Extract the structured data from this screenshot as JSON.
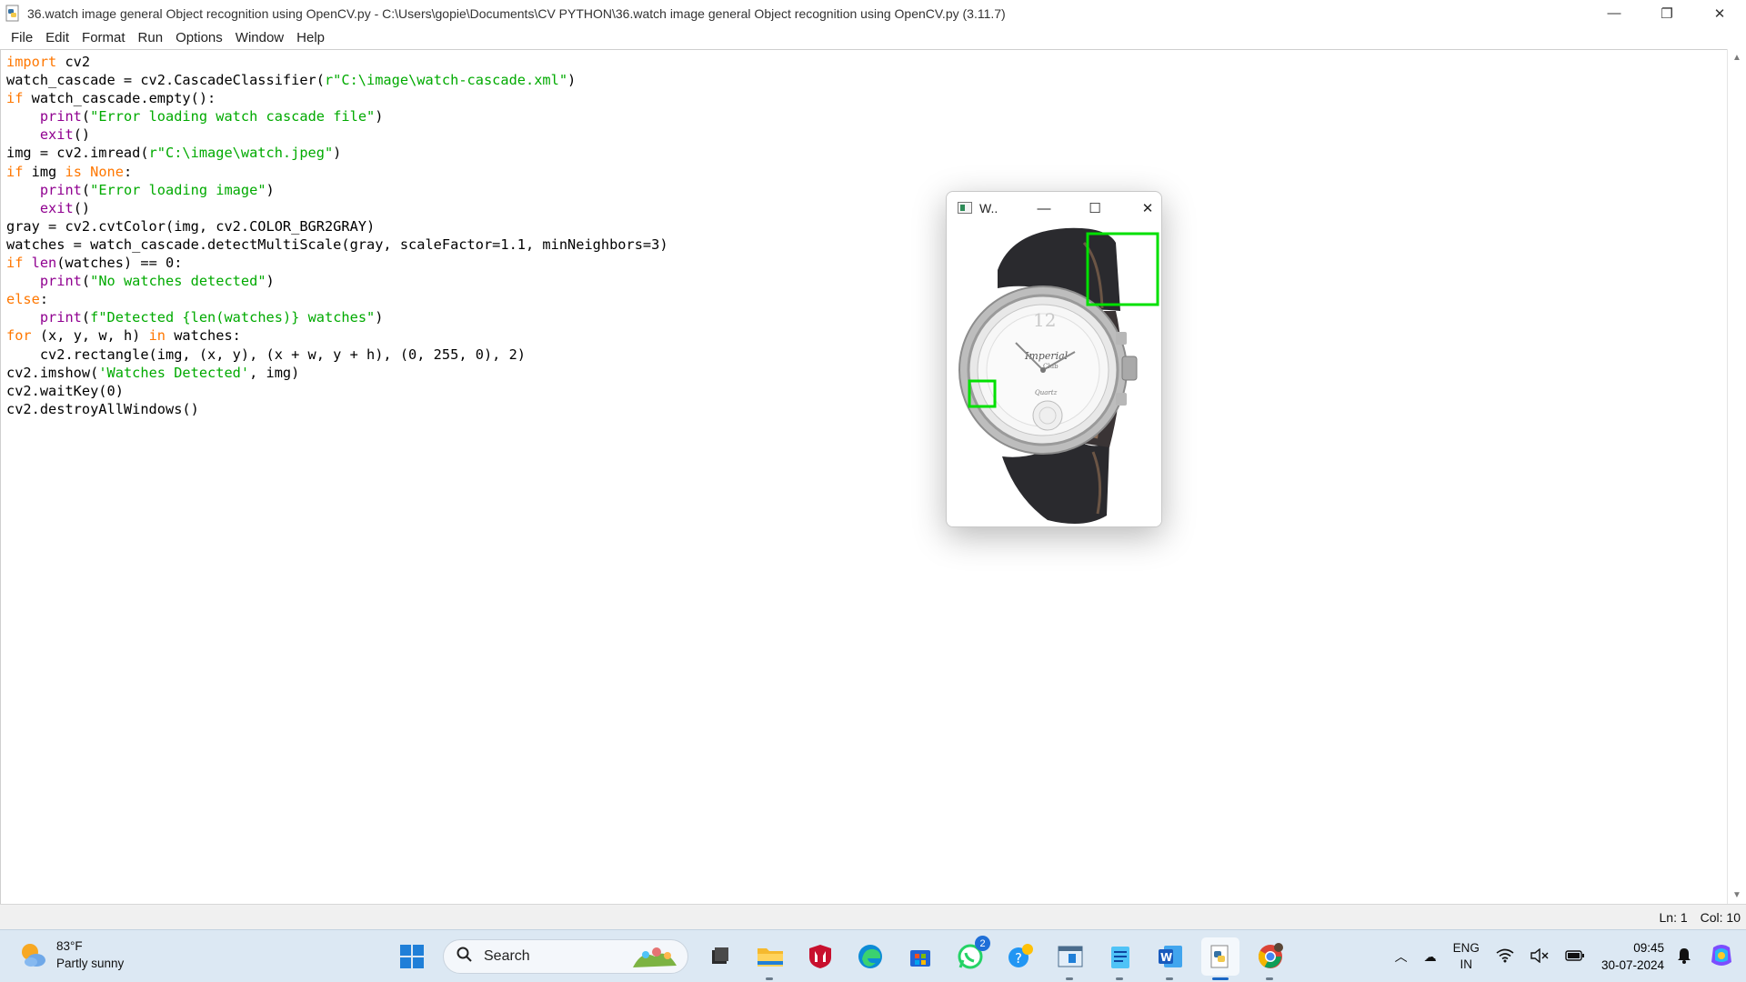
{
  "window": {
    "title": "36.watch image general Object recognition using OpenCV.py - C:\\Users\\gopie\\Documents\\CV PYTHON\\36.watch image general Object recognition using OpenCV.py (3.11.7)",
    "minimize_glyph": "—",
    "maximize_glyph": "❐",
    "close_glyph": "✕"
  },
  "menu": [
    "File",
    "Edit",
    "Format",
    "Run",
    "Options",
    "Window",
    "Help"
  ],
  "code_lines": [
    [
      [
        "kw",
        "import"
      ],
      [
        "df",
        " cv2"
      ]
    ],
    [
      [
        "df",
        "watch_cascade = cv2.CascadeClassifier("
      ],
      [
        "st",
        "r\"C:\\image\\watch-cascade.xml\""
      ],
      [
        "df",
        ")"
      ]
    ],
    [
      [
        "kw",
        "if"
      ],
      [
        "df",
        " watch_cascade.empty():"
      ]
    ],
    [
      [
        "df",
        "    "
      ],
      [
        "bi",
        "print"
      ],
      [
        "df",
        "("
      ],
      [
        "st",
        "\"Error loading watch cascade file\""
      ],
      [
        "df",
        ")"
      ]
    ],
    [
      [
        "df",
        "    "
      ],
      [
        "bi",
        "exit"
      ],
      [
        "df",
        "()"
      ]
    ],
    [
      [
        "df",
        "img = cv2.imread("
      ],
      [
        "st",
        "r\"C:\\image\\watch.jpeg\""
      ],
      [
        "df",
        ")"
      ]
    ],
    [
      [
        "kw",
        "if"
      ],
      [
        "df",
        " img "
      ],
      [
        "kw",
        "is"
      ],
      [
        "df",
        " "
      ],
      [
        "kw",
        "None"
      ],
      [
        "df",
        ":"
      ]
    ],
    [
      [
        "df",
        "    "
      ],
      [
        "bi",
        "print"
      ],
      [
        "df",
        "("
      ],
      [
        "st",
        "\"Error loading image\""
      ],
      [
        "df",
        ")"
      ]
    ],
    [
      [
        "df",
        "    "
      ],
      [
        "bi",
        "exit"
      ],
      [
        "df",
        "()"
      ]
    ],
    [
      [
        "df",
        "gray = cv2.cvtColor(img, cv2.COLOR_BGR2GRAY)"
      ]
    ],
    [
      [
        "df",
        "watches = watch_cascade.detectMultiScale(gray, scaleFactor=1.1, minNeighbors=3)"
      ]
    ],
    [
      [
        "kw",
        "if"
      ],
      [
        "df",
        " "
      ],
      [
        "bi",
        "len"
      ],
      [
        "df",
        "(watches) == 0:"
      ]
    ],
    [
      [
        "df",
        "    "
      ],
      [
        "bi",
        "print"
      ],
      [
        "df",
        "("
      ],
      [
        "st",
        "\"No watches detected\""
      ],
      [
        "df",
        ")"
      ]
    ],
    [
      [
        "kw",
        "else"
      ],
      [
        "df",
        ":"
      ]
    ],
    [
      [
        "df",
        "    "
      ],
      [
        "bi",
        "print"
      ],
      [
        "df",
        "("
      ],
      [
        "st",
        "f\"Detected {len(watches)} watches\""
      ],
      [
        "df",
        ")"
      ]
    ],
    [
      [
        "kw",
        "for"
      ],
      [
        "df",
        " (x, y, w, h) "
      ],
      [
        "kw",
        "in"
      ],
      [
        "df",
        " watches:"
      ]
    ],
    [
      [
        "df",
        "    cv2.rectangle(img, (x, y), (x + w, y + h), (0, 255, 0), 2)"
      ]
    ],
    [
      [
        "df",
        "cv2.imshow("
      ],
      [
        "st",
        "'Watches Detected'"
      ],
      [
        "df",
        ", img)"
      ]
    ],
    [
      [
        "df",
        "cv2.waitKey(0)"
      ]
    ],
    [
      [
        "df",
        "cv2.destroyAllWindows()"
      ]
    ]
  ],
  "status": {
    "line": "Ln: 1",
    "col": "Col: 10"
  },
  "cv_window": {
    "title": "W..",
    "minimize_glyph": "—",
    "maximize_glyph": "☐",
    "close_glyph": "✕",
    "dial_brand": "Imperial",
    "dial_sub": "Club",
    "dial_quartz": "Quartz",
    "dial_numeral": "12",
    "box_color": "#00e000"
  },
  "taskbar": {
    "weather_temp": "83°F",
    "weather_desc": "Partly sunny",
    "search_label": "Search",
    "whatsapp_badge": "2",
    "lang_top": "ENG",
    "lang_bottom": "IN",
    "time": "09:45",
    "date": "30-07-2024"
  }
}
